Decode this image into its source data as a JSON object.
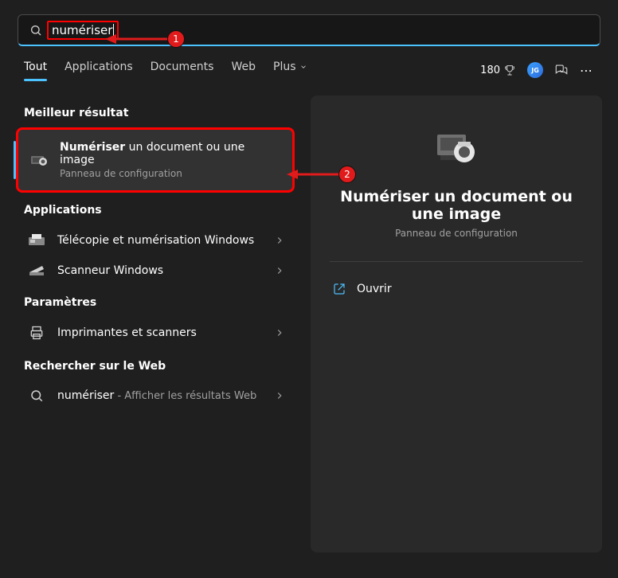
{
  "search": {
    "value": "numériser"
  },
  "tabs": {
    "all": "Tout",
    "apps": "Applications",
    "docs": "Documents",
    "web": "Web",
    "more": "Plus"
  },
  "points": "180",
  "sections": {
    "best": "Meilleur résultat",
    "apps": "Applications",
    "settings": "Paramètres",
    "web": "Rechercher sur le Web"
  },
  "best_result": {
    "title_bold": "Numériser",
    "title_rest": " un document ou une image",
    "subtitle": "Panneau de configuration"
  },
  "apps_list": [
    {
      "title": "Télécopie et numérisation Windows"
    },
    {
      "title": "Scanneur Windows"
    }
  ],
  "settings_list": [
    {
      "title": "Imprimantes et scanners"
    }
  ],
  "web_list": [
    {
      "term": "numériser",
      "suffix": " - Afficher les résultats Web"
    }
  ],
  "preview": {
    "title": "Numériser un document ou une image",
    "subtitle": "Panneau de configuration",
    "open": "Ouvrir"
  },
  "annotations": {
    "one": "1",
    "two": "2"
  }
}
